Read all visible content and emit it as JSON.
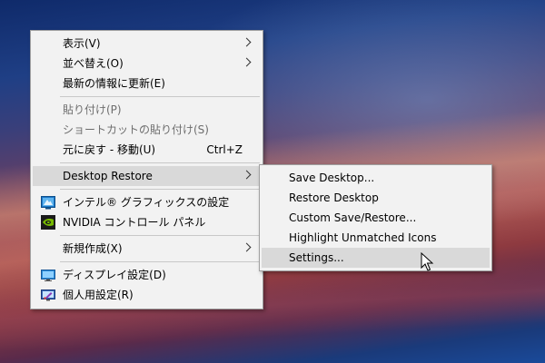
{
  "main_menu": {
    "items": [
      {
        "label": "表示(V)",
        "has_submenu": true
      },
      {
        "label": "並べ替え(O)",
        "has_submenu": true
      },
      {
        "label": "最新の情報に更新(E)"
      },
      {
        "label": "貼り付け(P)",
        "disabled": true
      },
      {
        "label": "ショートカットの貼り付け(S)",
        "disabled": true
      },
      {
        "label": "元に戻す - 移動(U)",
        "shortcut": "Ctrl+Z"
      },
      {
        "label": "Desktop Restore",
        "has_submenu": true,
        "highlighted": true
      },
      {
        "label": "インテル® グラフィックスの設定",
        "icon": "intel-graphics-icon"
      },
      {
        "label": "NVIDIA コントロール パネル",
        "icon": "nvidia-icon"
      },
      {
        "label": "新規作成(X)",
        "has_submenu": true
      },
      {
        "label": "ディスプレイ設定(D)",
        "icon": "display-icon"
      },
      {
        "label": "個人用設定(R)",
        "icon": "personalize-icon"
      }
    ]
  },
  "submenu": {
    "items": [
      {
        "label": "Save Desktop..."
      },
      {
        "label": "Restore Desktop"
      },
      {
        "label": "Custom Save/Restore..."
      },
      {
        "label": "Highlight Unmatched Icons"
      },
      {
        "label": "Settings...",
        "highlighted": true
      }
    ]
  },
  "colors": {
    "menu_bg": "#f2f2f2",
    "highlight": "#d9d9d9",
    "disabled_text": "#6d6d6d",
    "separator": "#c8c8c8"
  }
}
